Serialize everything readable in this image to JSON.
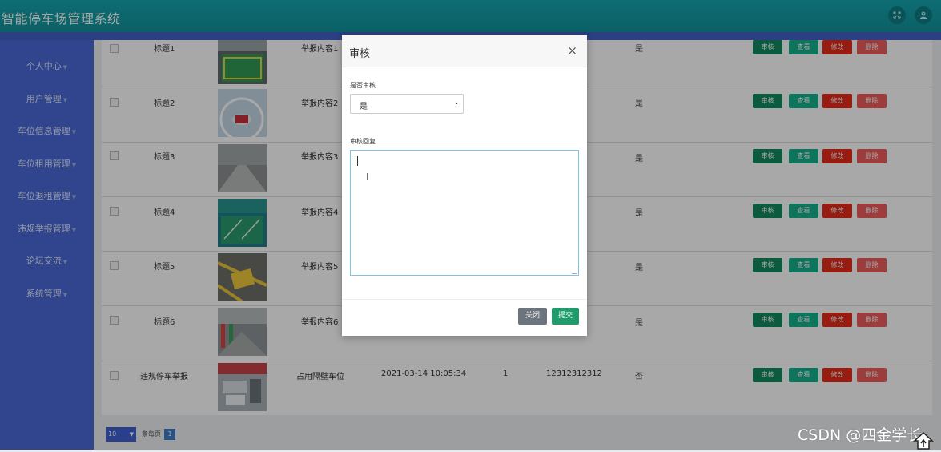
{
  "app": {
    "title": "智能停车场管理系统"
  },
  "header": {
    "fullscreen_icon": "expand-icon",
    "user_icon": "user-icon"
  },
  "sidebar": {
    "items": [
      {
        "label": "个人中心"
      },
      {
        "label": "用户管理"
      },
      {
        "label": "车位信息管理"
      },
      {
        "label": "车位租用管理"
      },
      {
        "label": "车位退租管理"
      },
      {
        "label": "违规举报管理"
      },
      {
        "label": "论坛交流"
      },
      {
        "label": "系统管理"
      }
    ]
  },
  "table": {
    "actions": {
      "audit": "审核",
      "view": "查看",
      "edit": "修改",
      "delete": "删除"
    },
    "rows": [
      {
        "title": "标题1",
        "content": "举报内容1",
        "time": "",
        "num": "",
        "phone": "",
        "status": "是"
      },
      {
        "title": "标题2",
        "content": "举报内容2",
        "time": "",
        "num": "",
        "phone": "",
        "status": "是"
      },
      {
        "title": "标题3",
        "content": "举报内容3",
        "time": "",
        "num": "",
        "phone": "",
        "status": "是"
      },
      {
        "title": "标题4",
        "content": "举报内容4",
        "time": "",
        "num": "",
        "phone": "",
        "status": "是"
      },
      {
        "title": "标题5",
        "content": "举报内容5",
        "time": "",
        "num": "",
        "phone": "",
        "status": "是"
      },
      {
        "title": "标题6",
        "content": "举报内容6",
        "time": "",
        "num": "",
        "phone": "",
        "status": "是"
      },
      {
        "title": "违规停车举报",
        "content": "占用隔壁车位",
        "time": "2021-03-14 10:05:34",
        "num": "1",
        "phone": "12312312312",
        "status": "否"
      }
    ]
  },
  "pagination": {
    "page_size": "10",
    "per_page_label": "条每页",
    "current_page": "1"
  },
  "modal": {
    "title": "审核",
    "close_symbol": "×",
    "audit_label": "是否审核",
    "audit_value": "是",
    "reply_label": "审核回复",
    "reply_value": "",
    "cancel_label": "关闭",
    "submit_label": "提交"
  },
  "watermark": "CSDN @四金学长"
}
